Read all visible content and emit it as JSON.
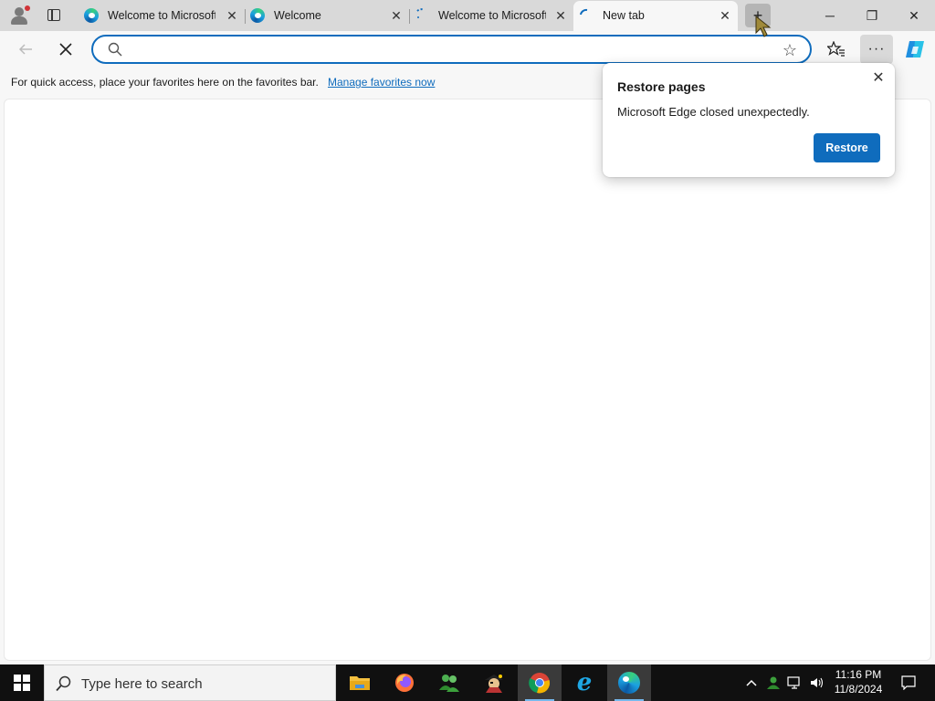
{
  "tabs": [
    {
      "title": "Welcome to Microsoft",
      "favicon": "edge-icon",
      "active": false
    },
    {
      "title": "Welcome",
      "favicon": "edge-icon",
      "active": false
    },
    {
      "title": "Welcome to Microsoft",
      "favicon": "loading-spinner-icon",
      "active": false
    },
    {
      "title": "New tab",
      "favicon": "loading-spinner-icon",
      "active": true
    }
  ],
  "tab_close_glyph": "✕",
  "window": {
    "minimize": "─",
    "maximize": "❐",
    "close": "✕"
  },
  "address_bar": {
    "value": "",
    "placeholder": ""
  },
  "favorites_bar": {
    "message": "For quick access, place your favorites here on the favorites bar.",
    "link": "Manage favorites now"
  },
  "popup": {
    "title": "Restore pages",
    "message": "Microsoft Edge closed unexpectedly.",
    "button": "Restore",
    "close_glyph": "✕"
  },
  "taskbar": {
    "search_placeholder": "Type here to search",
    "apps": [
      "file-explorer-icon",
      "firefox-icon",
      "people-icon",
      "pirate-game-icon",
      "chrome-icon",
      "internet-explorer-icon",
      "edge-icon"
    ],
    "clock_time": "11:16 PM",
    "clock_date": "11/8/2024"
  },
  "colors": {
    "accent": "#0f6cbd",
    "taskbar": "#101010"
  }
}
